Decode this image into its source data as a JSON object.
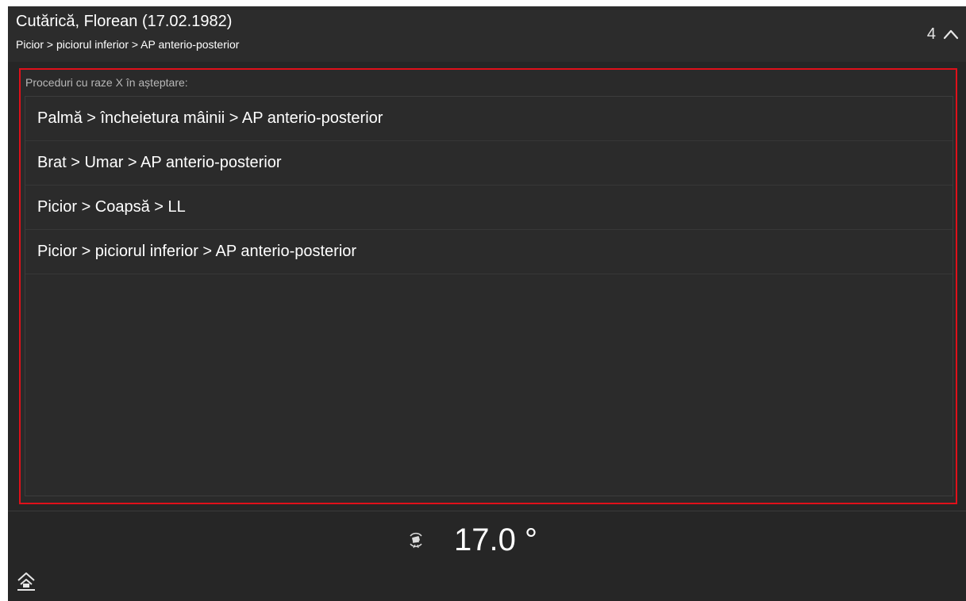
{
  "header": {
    "patient_name": "Cutărică, Florean (17.02.1982)",
    "current_procedure": "Picior > piciorul inferior > AP anterio-posterior",
    "pending_count": "4",
    "collapse_icon": "chevron-up-icon"
  },
  "pending_panel": {
    "label": "Proceduri cu raze X în așteptare:",
    "items": [
      {
        "label": "Palmă > încheietura mâinii > AP anterio-posterior"
      },
      {
        "label": "Brat > Umar > AP anterio-posterior"
      },
      {
        "label": "Picior > Coapsă > LL"
      },
      {
        "label": "Picior > piciorul inferior > AP anterio-posterior"
      }
    ],
    "border_color": "#e0101a"
  },
  "status": {
    "tilt_icon": "tube-tilt-icon",
    "angle": "17.0 °"
  },
  "footer": {
    "home_icon": "home-icon"
  },
  "colors": {
    "background": "#262626",
    "header_background": "#2c2c2c",
    "text": "#ffffff",
    "muted_text": "#b8b8b8",
    "highlight_border": "#e0101a"
  }
}
